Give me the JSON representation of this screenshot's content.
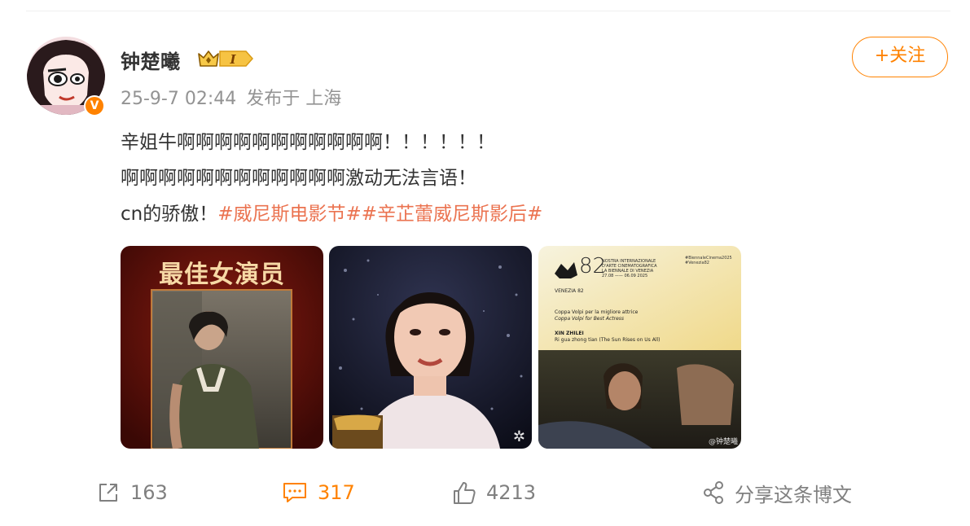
{
  "user": {
    "name": "钟楚曦",
    "verified_mark": "V",
    "vip_level": "I"
  },
  "post": {
    "date": "25-9-7 02:44",
    "location": "发布于 上海",
    "lines": [
      "辛姐牛啊啊啊啊啊啊啊啊啊啊啊！！！！！！",
      "啊啊啊啊啊啊啊啊啊啊啊啊激动无法言语！",
      "cn的骄傲！"
    ],
    "tags": [
      "#威尼斯电影节#",
      "#辛芷蕾威尼斯影后#"
    ]
  },
  "follow_label": "+关注",
  "images": [
    {
      "caption": "最佳女演员"
    },
    {
      "watermark": "✲"
    },
    {
      "edition": "82",
      "festival_lines": [
        "NOSTRA INTERNAZIONALE",
        "D'ARTE CINEMATOGRAFICA",
        "LA BIENNALE DI VENEZIA"
      ],
      "dates": "27.08 —— 06.09 2025",
      "hashtags": [
        "#BiennaleCinema2025",
        "#Venezia82"
      ],
      "venezia": "VENEZIA 82",
      "award_it": "Coppa Volpi per la migliore attrice",
      "award_en": "Coppa Volpi for Best Actress",
      "winner": "XIN ZHILEI",
      "film": "Ri gua zhong tian (The Sun Rises on Us All)",
      "watermark": "@钟楚曦"
    }
  ],
  "actions": {
    "forward_count": "163",
    "comment_count": "317",
    "like_count": "4213",
    "share_label": "分享这条博文"
  },
  "colors": {
    "accent": "#ff8200",
    "tag": "#eb7350",
    "meta": "#939393"
  }
}
